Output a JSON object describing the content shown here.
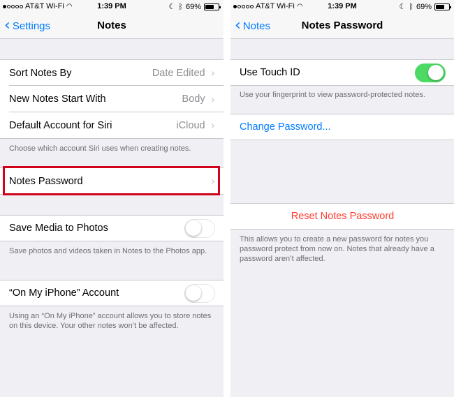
{
  "status": {
    "carrier": "AT&T Wi-Fi",
    "time": "1:39 PM",
    "battery": "69%",
    "battery_level": 0.69
  },
  "left": {
    "back_label": "Settings",
    "title": "Notes",
    "sort_label": "Sort Notes By",
    "sort_value": "Date Edited",
    "new_label": "New Notes Start With",
    "new_value": "Body",
    "siri_label": "Default Account for Siri",
    "siri_value": "iCloud",
    "siri_footer": "Choose which account Siri uses when creating notes.",
    "password_label": "Notes Password",
    "save_media_label": "Save Media to Photos",
    "save_media_footer": "Save photos and videos taken in Notes to the Photos app.",
    "on_iphone_label": "“On My iPhone” Account",
    "on_iphone_footer": "Using an “On My iPhone” account allows you to store notes on this device. Your other notes won’t be affected.",
    "highlight_color": "#d0021b"
  },
  "right": {
    "back_label": "Notes",
    "title": "Notes Password",
    "touch_id_label": "Use Touch ID",
    "touch_id_on": true,
    "touch_id_footer": "Use your fingerprint to view password-protected notes.",
    "change_label": "Change Password...",
    "reset_label": "Reset Notes Password",
    "reset_footer": "This allows you to create a new password for notes you password protect from now on. Notes that already have a password aren’t affected."
  },
  "colors": {
    "accent": "#007aff",
    "toggle_on": "#4cd964",
    "destructive": "#ff3b30"
  },
  "icons": {
    "signal": "signal-dots-icon",
    "wifi": "wifi-icon",
    "moon": "moon-icon",
    "bluetooth": "bluetooth-icon",
    "battery": "battery-icon",
    "back": "chevron-left-icon",
    "disclosure": "chevron-right-icon"
  }
}
